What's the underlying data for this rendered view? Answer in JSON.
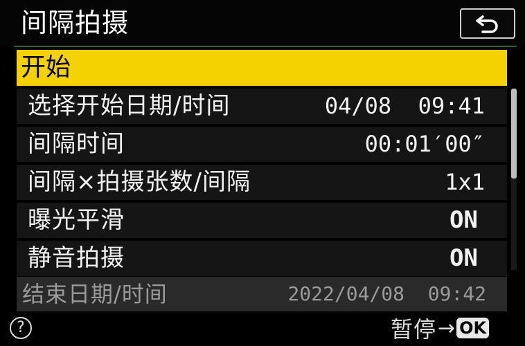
{
  "header": {
    "title": "间隔拍摄",
    "back_icon": "return-arrow-icon"
  },
  "start": {
    "label": "开始"
  },
  "menu": {
    "items": [
      {
        "label": "选择开始日期/时间",
        "value": "04/08  09:41"
      },
      {
        "label": "间隔时间",
        "value": "00:01′00″"
      },
      {
        "label": "间隔×拍摄张数/间隔",
        "value": "1x1"
      },
      {
        "label": "曝光平滑",
        "value": "ON"
      },
      {
        "label": "静音拍摄",
        "value": "ON"
      }
    ]
  },
  "end": {
    "label": "结束日期/时间",
    "value": "2022/04/08  09:42"
  },
  "footer": {
    "help_symbol": "?",
    "pause_label": "暂停",
    "arrow": "→",
    "ok_label": "OK"
  },
  "colors": {
    "highlight": "#f4d100",
    "background": "#000000"
  }
}
